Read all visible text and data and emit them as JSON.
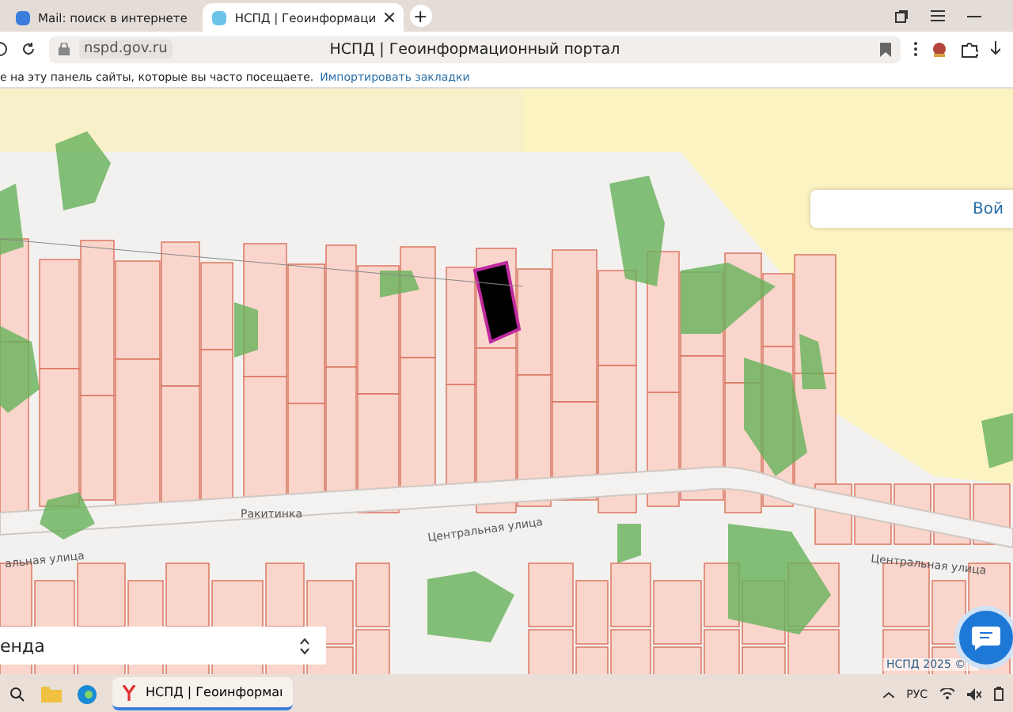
{
  "tabs": [
    {
      "label": "Mail: поиск в интернете",
      "selected": false
    },
    {
      "label": "НСПД | Геоинформаци",
      "selected": true
    }
  ],
  "new_tab": "+",
  "address_bar": {
    "domain": "nspd.gov.ru",
    "page_title": "НСПД | Геоинформационный портал"
  },
  "bookmarks_bar": {
    "hint": "е на эту панель сайты, которые вы часто посещаете.",
    "link": "Импортировать закладки"
  },
  "map": {
    "login_button": "Вой",
    "labels": [
      {
        "text": "Ракитинка"
      },
      {
        "text": "Центральная улица"
      },
      {
        "text": "альная улица"
      },
      {
        "text": "Центральная улица"
      }
    ],
    "layer_select": {
      "value": "енда"
    },
    "attribution": "НСПД 2025 ©"
  },
  "taskbar": {
    "app": {
      "label": "НСПД | Геоинформаı",
      "selected": true
    },
    "language": "РУС"
  }
}
